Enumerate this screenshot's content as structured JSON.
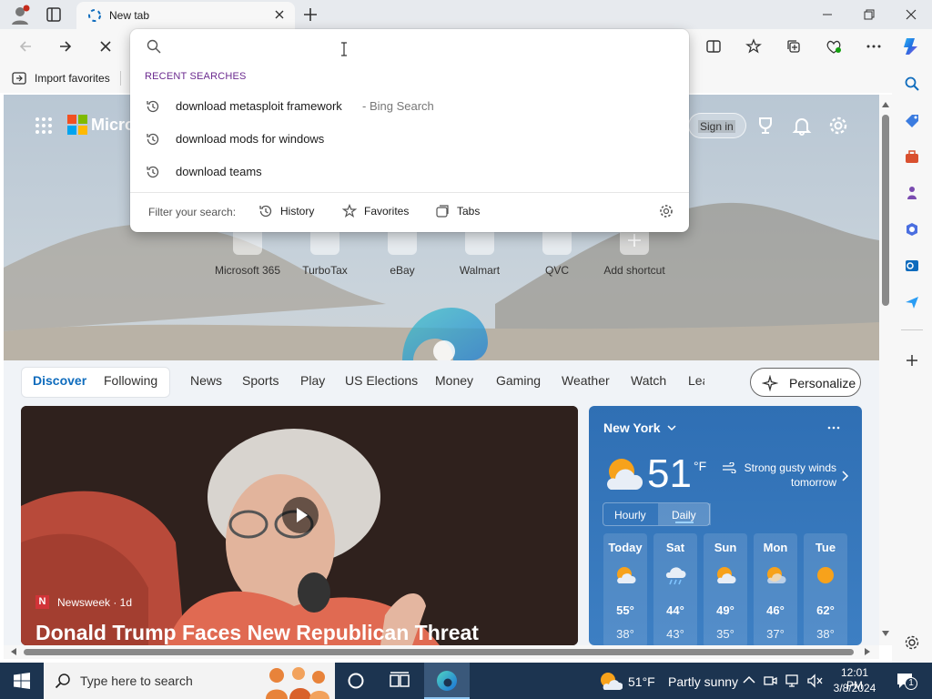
{
  "browser": {
    "tab_title": "New tab",
    "favorites_bar": {
      "import_label": "Import favorites"
    }
  },
  "address_dropdown": {
    "query": "",
    "section_title": "RECENT SEARCHES",
    "suggestions": [
      {
        "text": "download metasploit framework",
        "suffix": "- Bing Search"
      },
      {
        "text": "download mods for windows",
        "suffix": ""
      },
      {
        "text": "download teams",
        "suffix": ""
      }
    ],
    "filter_label": "Filter your search:",
    "filters": [
      "History",
      "Favorites",
      "Tabs"
    ]
  },
  "newtab": {
    "brand_partial": "Micro",
    "sign_in_label": "Sign in",
    "shortcuts": [
      "Microsoft 365",
      "TurboTax",
      "eBay",
      "Walmart",
      "QVC",
      "Add shortcut"
    ],
    "feed_tabs": [
      "Discover",
      "Following",
      "News",
      "Sports",
      "Play",
      "US Elections",
      "Money",
      "Gaming",
      "Weather",
      "Watch",
      "Lea"
    ],
    "personalize_label": "Personalize",
    "hero": {
      "source": "Newsweek · 1d",
      "source_logo_letter": "N",
      "headline": "Donald Trump Faces New Republican Threat"
    },
    "weather": {
      "location": "New York",
      "temperature": "51",
      "unit": "°F",
      "forecast_note": "Strong gusty winds tomorrow",
      "toggle": [
        "Hourly",
        "Daily"
      ],
      "days": [
        {
          "name": "Today",
          "high": "55°",
          "low": "38°",
          "icon": "partly-sunny-icon"
        },
        {
          "name": "Sat",
          "high": "44°",
          "low": "43°",
          "icon": "rain-icon"
        },
        {
          "name": "Sun",
          "high": "49°",
          "low": "35°",
          "icon": "partly-sunny-icon"
        },
        {
          "name": "Mon",
          "high": "46°",
          "low": "37°",
          "icon": "partly-sunny-icon"
        },
        {
          "name": "Tue",
          "high": "62°",
          "low": "38°",
          "icon": "sunny-icon"
        }
      ]
    }
  },
  "taskbar": {
    "search_placeholder": "Type here to search",
    "weather_temp": "51°F",
    "weather_desc": "Partly sunny",
    "time": "12:01 PM",
    "date": "3/8/2024",
    "notification_count": "1"
  },
  "colors": {
    "accent": "#0f6cbd",
    "taskbar": "#1c3450",
    "weather_card": "#3d7fc3"
  }
}
